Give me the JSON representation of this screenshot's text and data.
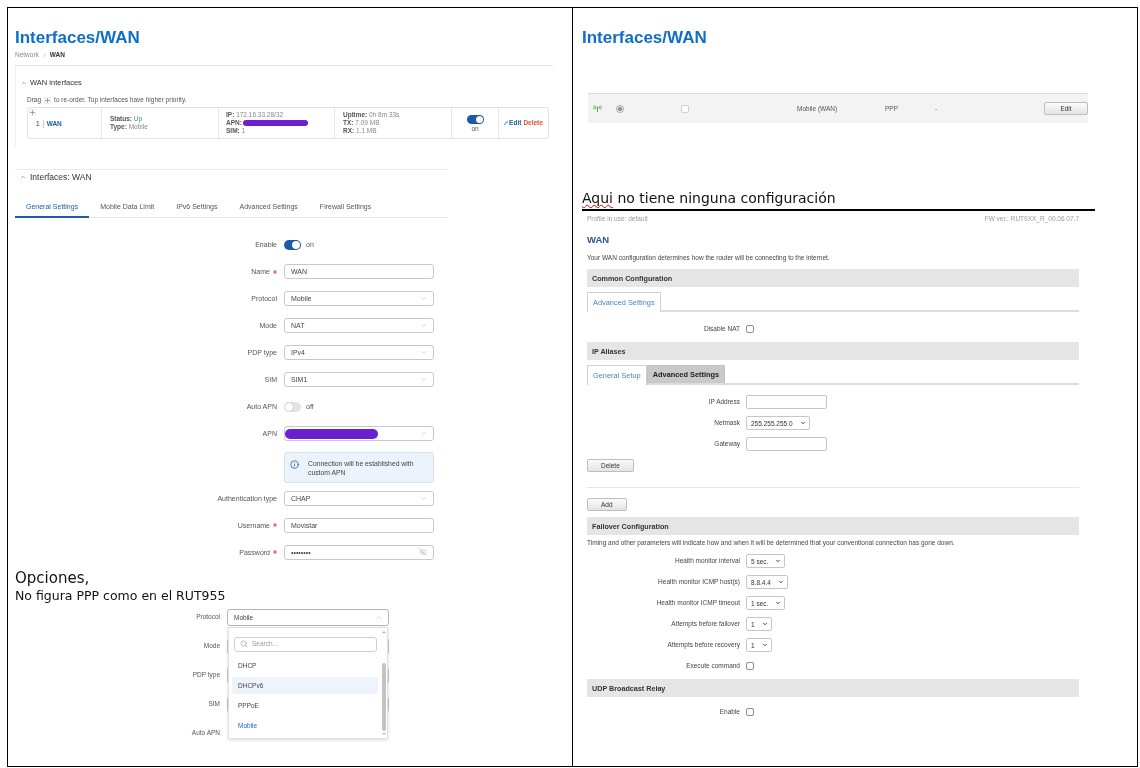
{
  "left": {
    "title": "Interfaces/WAN",
    "breadcrumb": [
      "Network",
      "WAN"
    ],
    "wan_interfaces": {
      "title": "WAN interfaces",
      "expanded": true,
      "hint_start": "Drag",
      "hint_end": "to re-order. Top interfaces have higher priority.",
      "rows": [
        {
          "index": "1",
          "name": "WAN",
          "status": [
            {
              "label": "Status:",
              "value": "Up",
              "kind": "state"
            },
            {
              "label": "Type:",
              "value": "Mobile",
              "kind": "plain"
            }
          ],
          "connection": [
            {
              "label": "IP:",
              "value": "172.16.33.28/32",
              "redacted": false
            },
            {
              "label": "APN:",
              "redacted": true
            },
            {
              "label": "SIM:",
              "value": "1",
              "redacted": false
            }
          ],
          "traffic": [
            {
              "label": "Uptime:",
              "value": "0h 8m 33s"
            },
            {
              "label": "TX:",
              "value": "7.09 MB"
            },
            {
              "label": "RX:",
              "value": "1.1 MB"
            }
          ],
          "on": true,
          "switch_label": "on",
          "actions": [
            {
              "label": "Edit",
              "kind": "edit"
            },
            {
              "label": "Delete",
              "kind": "delete"
            }
          ]
        }
      ]
    },
    "interface": {
      "title": "Interfaces: WAN",
      "expanded": true,
      "tabs": [
        {
          "label": "General Settings",
          "selected": true
        },
        {
          "label": "Mobile Data Limit",
          "selected": false
        },
        {
          "label": "IPv6 Settings",
          "selected": false
        },
        {
          "label": "Advanced Settings",
          "selected": false
        },
        {
          "label": "Firewall Settings",
          "selected": false
        }
      ],
      "fields": [
        {
          "kind": "toggle",
          "label": "Enable",
          "required": false,
          "on": true,
          "state_label": "on"
        },
        {
          "kind": "text",
          "label": "Name",
          "required": true,
          "value": "WAN"
        },
        {
          "kind": "select",
          "label": "Protocol",
          "required": false,
          "value": "Mobile"
        },
        {
          "kind": "select",
          "label": "Mode",
          "required": false,
          "value": "NAT"
        },
        {
          "kind": "select",
          "label": "PDP type",
          "required": false,
          "value": "IPv4"
        },
        {
          "kind": "select",
          "label": "SIM",
          "required": false,
          "value": "SIM1"
        },
        {
          "kind": "toggle",
          "label": "Auto APN",
          "required": false,
          "on": false,
          "state_label": "off"
        },
        {
          "kind": "select",
          "label": "APN",
          "required": false,
          "redacted": true
        },
        {
          "kind": "info",
          "text": "Connection will be established with custom APN"
        },
        {
          "kind": "select",
          "label": "Authentication type",
          "required": false,
          "value": "CHAP"
        },
        {
          "kind": "text",
          "label": "Username",
          "required": true,
          "value": "Movistar"
        },
        {
          "kind": "password",
          "label": "Password",
          "required": true,
          "value": "••••••••"
        }
      ]
    },
    "note": {
      "heading": "Opciones,",
      "text": "No figura PPP como en el RUT955"
    },
    "protocol_menu": {
      "label": "Protocol",
      "value": "Mobile",
      "expanded": true,
      "search_placeholder": "Search...",
      "options": [
        {
          "label": "DHCP",
          "selected": false,
          "hovered": false
        },
        {
          "label": "DHCPv6",
          "selected": false,
          "hovered": true
        },
        {
          "label": "PPPoE",
          "selected": false,
          "hovered": false
        },
        {
          "label": "Mobile",
          "selected": true,
          "hovered": false
        }
      ],
      "rows_behind": [
        {
          "label": "Mode",
          "kind": "select"
        },
        {
          "label": "PDP type",
          "kind": "select"
        },
        {
          "label": "SIM",
          "kind": "select"
        },
        {
          "label": "Auto APN",
          "kind": "toggle"
        }
      ]
    }
  },
  "right": {
    "title": "Interfaces/WAN",
    "interface_row": {
      "selected": true,
      "checked": false,
      "cells": [
        "Mobile (WAN)",
        "PPP",
        "-"
      ],
      "button": "Edit"
    },
    "note": [
      {
        "text": "Aqui",
        "misspelled": true
      },
      {
        "text": "no tiene ninguna configuración",
        "misspelled": false
      }
    ],
    "page": {
      "profile": "Profile in use: default",
      "firmware": "FW ver.: RUT9XX_R_00.06.07.7",
      "title": "WAN",
      "description": "Your WAN configuration determines how the router will be connecting to the internet.",
      "sections": [
        {
          "title": "Common Configuration",
          "tabs": [
            {
              "label": "Advanced Settings",
              "selected": true
            }
          ],
          "fields": [
            {
              "kind": "checkbox",
              "label": "Disable NAT",
              "checked": false
            }
          ]
        },
        {
          "title": "IP Aliases",
          "tabs": [
            {
              "label": "General Setup",
              "selected": true
            },
            {
              "label": "Advanced Settings",
              "selected": false
            }
          ],
          "fields": [
            {
              "kind": "input",
              "label": "IP Address"
            },
            {
              "kind": "select",
              "label": "Netmask",
              "value": "255.255.255.0"
            },
            {
              "kind": "input",
              "label": "Gateway"
            }
          ],
          "delete_button": "Delete",
          "add_button": "Add"
        },
        {
          "title": "Failover Configuration",
          "description": "Timing and other parameters will indicate how and when it will be determined that your conventional connection has gone down.",
          "fields": [
            {
              "kind": "select",
              "label": "Health monitor interval",
              "value": "5 sec."
            },
            {
              "kind": "select",
              "label": "Health monitor ICMP host(s)",
              "value": "8.8.4.4"
            },
            {
              "kind": "select",
              "label": "Health monitor ICMP timeout",
              "value": "1 sec."
            },
            {
              "kind": "select",
              "label": "Attempts before failover",
              "value": "1"
            },
            {
              "kind": "select",
              "label": "Attempts before recovery",
              "value": "1"
            },
            {
              "kind": "checkbox",
              "label": "Execute command",
              "checked": false
            }
          ]
        },
        {
          "title": "UDP Broadcast Relay",
          "fields": [
            {
              "kind": "checkbox",
              "label": "Enable",
              "checked": false
            }
          ]
        }
      ]
    }
  }
}
